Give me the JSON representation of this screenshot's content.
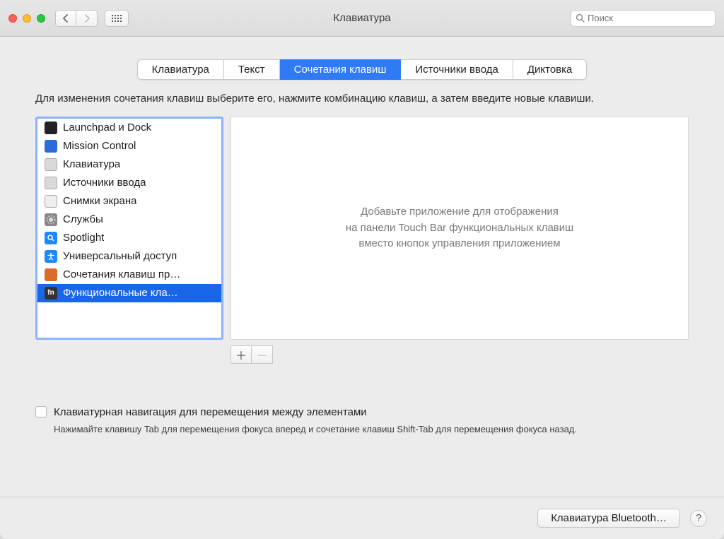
{
  "window": {
    "title": "Клавиатура"
  },
  "search": {
    "placeholder": "Поиск"
  },
  "tabs": [
    {
      "label": "Клавиатура",
      "active": false
    },
    {
      "label": "Текст",
      "active": false
    },
    {
      "label": "Сочетания клавиш",
      "active": true
    },
    {
      "label": "Источники ввода",
      "active": false
    },
    {
      "label": "Диктовка",
      "active": false
    }
  ],
  "instructions": "Для изменения сочетания клавиш выберите его, нажмите комбинацию клавиш, а затем введите новые клавиши.",
  "sidebar": {
    "items": [
      {
        "label": "Launchpad и Dock",
        "icon": "launchpad",
        "selected": false
      },
      {
        "label": "Mission Control",
        "icon": "mission",
        "selected": false
      },
      {
        "label": "Клавиатура",
        "icon": "keyboard",
        "selected": false
      },
      {
        "label": "Источники ввода",
        "icon": "input",
        "selected": false
      },
      {
        "label": "Снимки экрана",
        "icon": "screenshot",
        "selected": false
      },
      {
        "label": "Службы",
        "icon": "services",
        "selected": false
      },
      {
        "label": "Spotlight",
        "icon": "spotlight",
        "selected": false
      },
      {
        "label": "Универсальный доступ",
        "icon": "accessibility",
        "selected": false
      },
      {
        "label": "Сочетания клавиш пр…",
        "icon": "appshortcuts",
        "selected": false
      },
      {
        "label": "Функциональные кла…",
        "icon": "fn",
        "selected": true
      }
    ]
  },
  "right_pane": {
    "line1": "Добавьте приложение для отображения",
    "line2": "на панели Touch Bar функциональных клавиш",
    "line3": "вместо кнопок управления приложением"
  },
  "buttons": {
    "plus": "＋",
    "minus": "－"
  },
  "checkbox": {
    "label": "Клавиатурная навигация для перемещения между элементами"
  },
  "hint": "Нажимайте клавишу Tab для перемещения фокуса вперед и сочетание клавиш Shift-Tab для перемещения фокуса назад.",
  "footer": {
    "bluetooth": "Клавиатура Bluetooth…",
    "help": "?"
  }
}
